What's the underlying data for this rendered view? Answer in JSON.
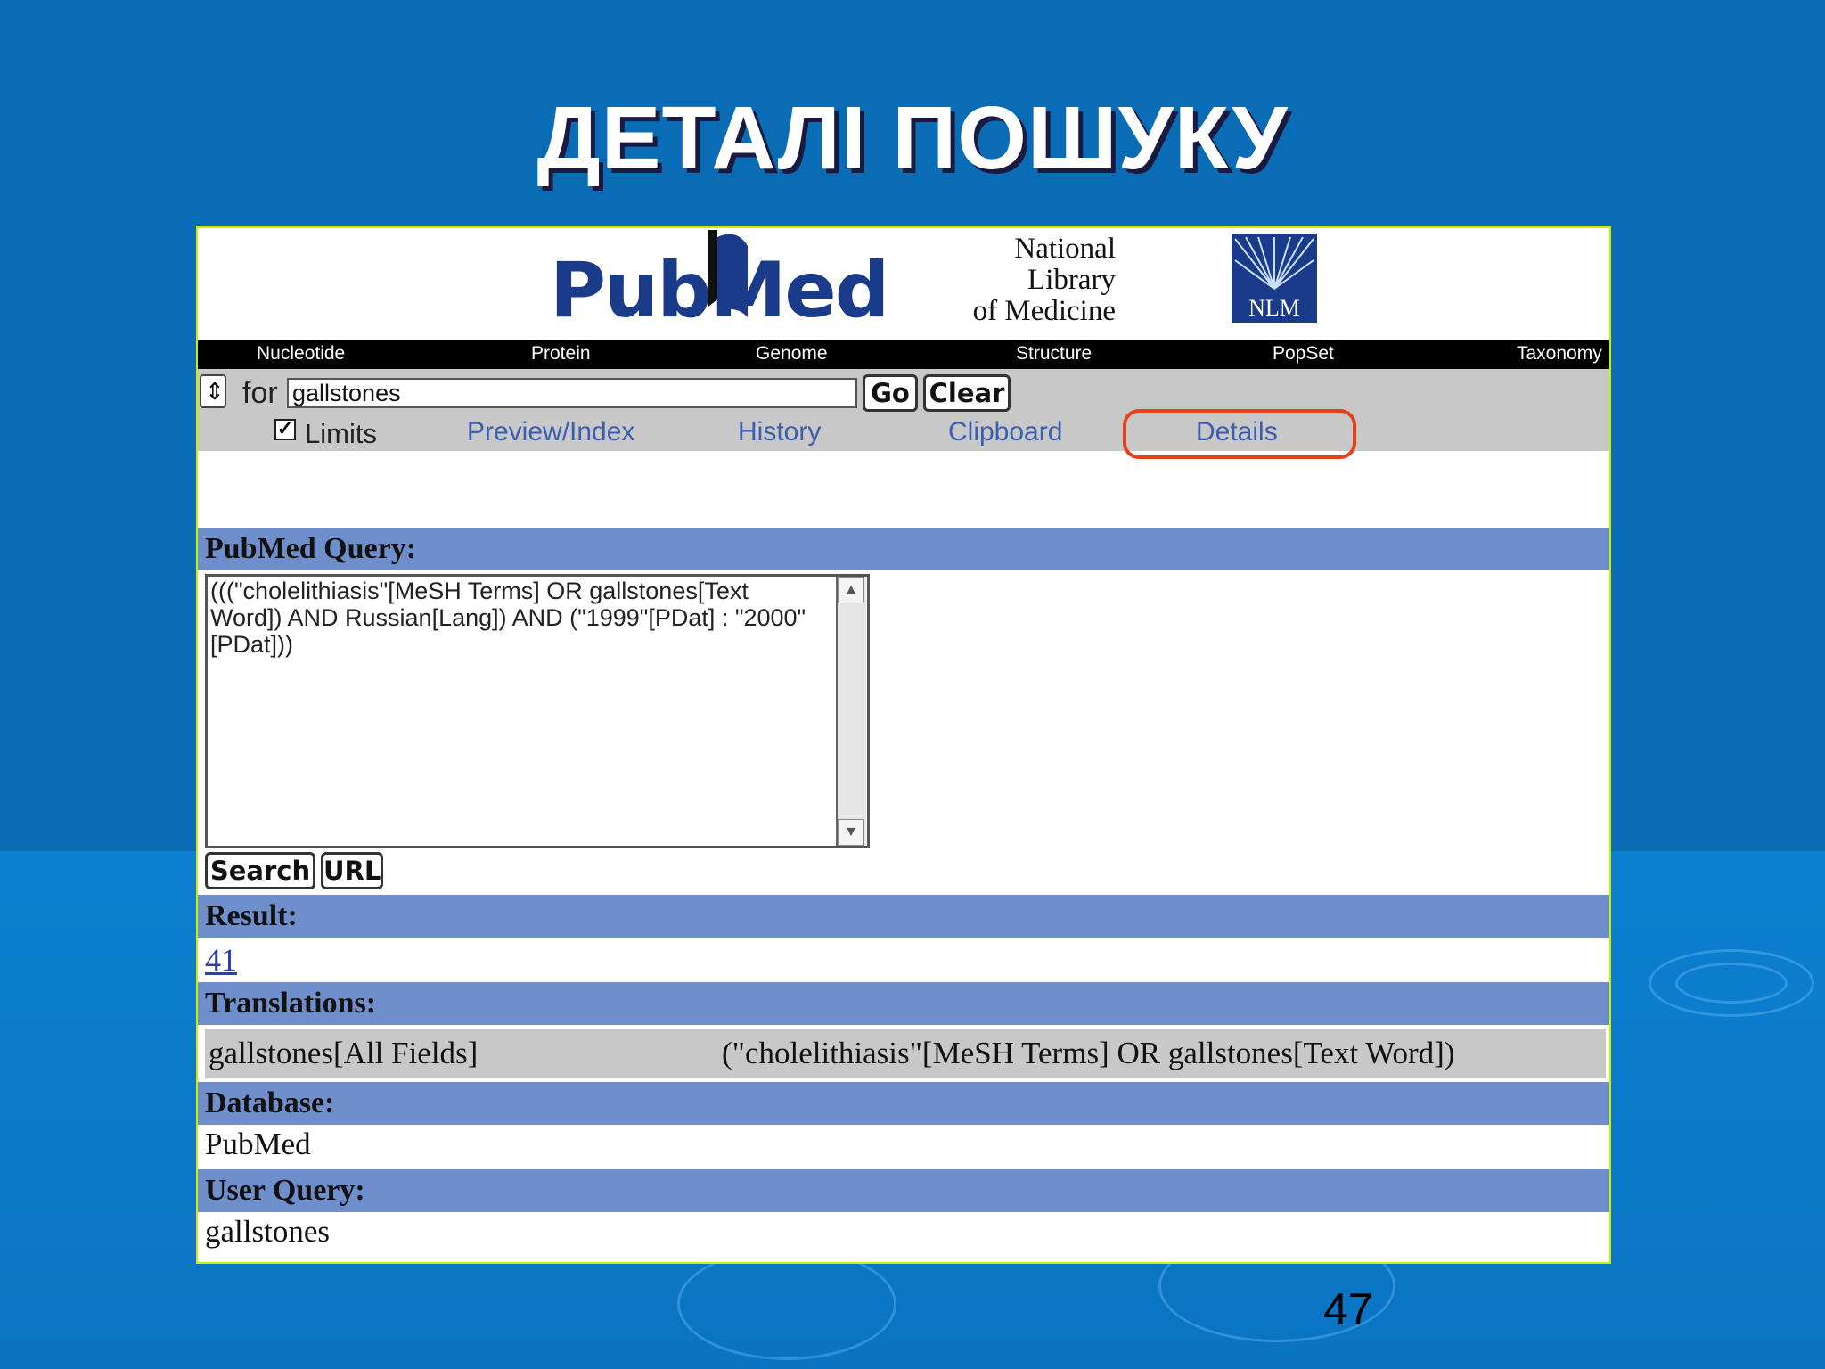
{
  "slide": {
    "title": "ДЕТАЛІ ПОШУКУ",
    "page_number": "47"
  },
  "header": {
    "logo": "PubMed",
    "nlm_lines": [
      "National",
      "Library",
      "of Medicine"
    ],
    "nlm_badge": "NLM"
  },
  "navbar": {
    "items": [
      "Nucleotide",
      "Protein",
      "Genome",
      "Structure",
      "PopSet",
      "Taxonomy"
    ]
  },
  "search": {
    "database_stepper": "⇕",
    "for_label": "for",
    "value": "gallstones",
    "go_label": "Go",
    "clear_label": "Clear"
  },
  "tabs": {
    "limits": "Limits",
    "limits_checked": "✓",
    "preview": "Preview/Index",
    "history": "History",
    "clipboard": "Clipboard",
    "details": "Details"
  },
  "details": {
    "query_heading": "PubMed Query:",
    "query_text": "(((\"cholelithiasis\"[MeSH Terms] OR gallstones[Text Word]) AND Russian[Lang]) AND (\"1999\"[PDat] : \"2000\"[PDat]))",
    "search_button": "Search",
    "url_button": "URL",
    "result_heading": "Result:",
    "result_value": "41",
    "translations_heading": "Translations:",
    "translation_term": "gallstones[All Fields]",
    "translation_value": "(\"cholelithiasis\"[MeSH Terms] OR gallstones[Text Word])",
    "database_heading": "Database:",
    "database_value": "PubMed",
    "user_query_heading": "User Query:",
    "user_query_value": "gallstones"
  },
  "colors": {
    "slide_background": "#0a6cb4",
    "section_header": "#6f8fcc",
    "highlight_ring": "#e8401a",
    "logo_blue": "#1a3a8a",
    "link_blue": "#3a5fb0"
  }
}
